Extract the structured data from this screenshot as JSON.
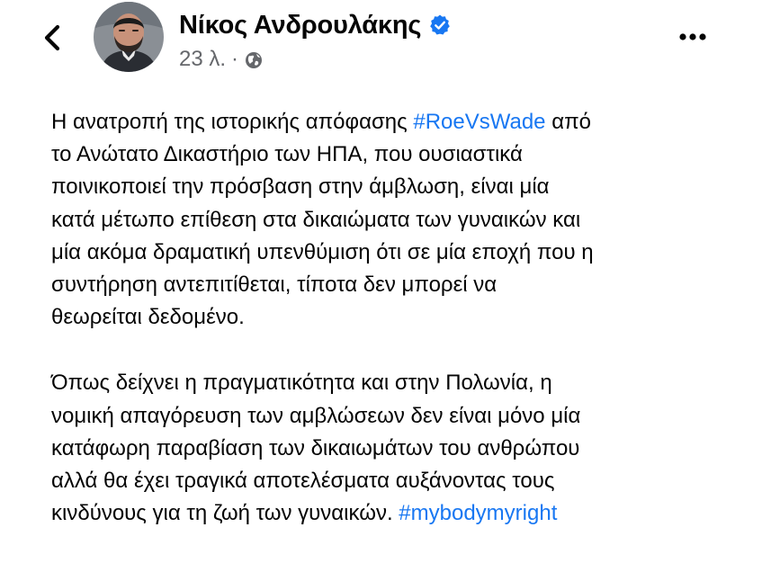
{
  "post": {
    "author": {
      "name": "Νίκος Ανδρουλάκης",
      "verified": true,
      "verified_icon": "verified-badge-icon"
    },
    "timestamp": "23 λ.",
    "meta_separator": "·",
    "audience_icon": "globe-icon",
    "header_icons": {
      "back": "chevron-left-icon",
      "more": "more-horizontal-icon"
    },
    "paragraphs": [
      {
        "lines": [
          {
            "parts": [
              {
                "text": "Η ανατροπή της ιστορικής απόφασης "
              },
              {
                "text": "#RoeVsWade",
                "hashtag": true
              },
              {
                "text": " από"
              }
            ]
          },
          {
            "parts": [
              {
                "text": "το Ανώτατο Δικαστήριο των ΗΠΑ, που ουσιαστικά"
              }
            ]
          },
          {
            "parts": [
              {
                "text": "ποινικοποιεί την πρόσβαση στην άμβλωση, είναι μία"
              }
            ]
          },
          {
            "parts": [
              {
                "text": "κατά μέτωπο επίθεση στα δικαιώματα των γυναικών και"
              }
            ]
          },
          {
            "parts": [
              {
                "text": "μία ακόμα δραματική υπενθύμιση ότι σε μία εποχή που η"
              }
            ]
          },
          {
            "parts": [
              {
                "text": "συντήρηση αντεπιτίθεται, τίποτα δεν μπορεί να"
              }
            ]
          },
          {
            "parts": [
              {
                "text": "θεωρείται δεδομένο."
              }
            ]
          }
        ]
      },
      {
        "lines": [
          {
            "parts": [
              {
                "text": "Όπως δείχνει η πραγματικότητα και στην Πολωνία, η"
              }
            ]
          },
          {
            "parts": [
              {
                "text": "νομική απαγόρευση των αμβλώσεων δεν είναι μόνο μία"
              }
            ]
          },
          {
            "parts": [
              {
                "text": "κατάφωρη παραβίαση των δικαιωμάτων του ανθρώπου"
              }
            ]
          },
          {
            "parts": [
              {
                "text": "αλλά θα έχει τραγικά αποτελέσματα αυξάνοντας τους"
              }
            ]
          },
          {
            "parts": [
              {
                "text": "κινδύνους για τη ζωή των γυναικών. "
              },
              {
                "text": "#mybodymyright",
                "hashtag": true
              }
            ]
          }
        ]
      }
    ],
    "colors": {
      "text": "#050505",
      "meta_text": "#65676b",
      "hashtag": "#1877f2",
      "verified_badge": "#1877f2"
    }
  }
}
